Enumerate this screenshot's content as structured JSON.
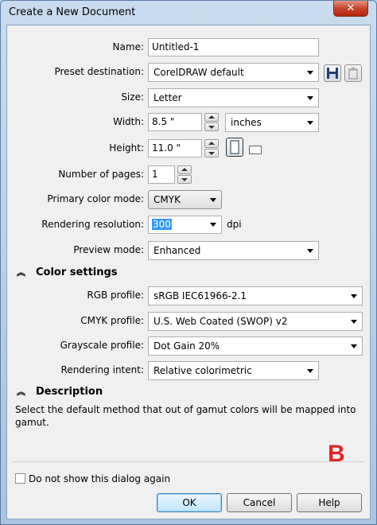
{
  "window": {
    "title": "Create a New Document",
    "close_glyph": "✕"
  },
  "form": {
    "name_label": "Name:",
    "name_value": "Untitled-1",
    "preset_label": "Preset destination:",
    "preset_value": "CorelDRAW default",
    "size_label": "Size:",
    "size_value": "Letter",
    "width_label": "Width:",
    "width_value": "8.5 \"",
    "units_value": "inches",
    "height_label": "Height:",
    "height_value": "11.0 \"",
    "pages_label": "Number of pages:",
    "pages_value": "1",
    "color_mode_label": "Primary color mode:",
    "color_mode_value": "CMYK",
    "resolution_label": "Rendering resolution:",
    "resolution_value": "300",
    "resolution_unit": "dpi",
    "preview_label": "Preview mode:",
    "preview_value": "Enhanced"
  },
  "color_settings": {
    "heading": "Color settings",
    "rgb_label": "RGB profile:",
    "rgb_value": "sRGB IEC61966-2.1",
    "cmyk_label": "CMYK profile:",
    "cmyk_value": "U.S. Web Coated (SWOP) v2",
    "gray_label": "Grayscale profile:",
    "gray_value": "Dot Gain 20%",
    "intent_label": "Rendering intent:",
    "intent_value": "Relative colorimetric"
  },
  "description": {
    "heading": "Description",
    "text": "Select the default method that out of gamut colors will be mapped into gamut."
  },
  "overlay_mark": "B",
  "footer": {
    "checkbox_label": "Do not show this dialog again",
    "ok_label": "OK",
    "cancel_label": "Cancel",
    "help_label": "Help"
  },
  "icons": {
    "save_preset": "floppy-disk-icon",
    "delete_preset": "trash-icon",
    "portrait": "portrait-page-icon",
    "landscape": "landscape-page-icon",
    "collapse": "double-chevron-up-icon"
  }
}
